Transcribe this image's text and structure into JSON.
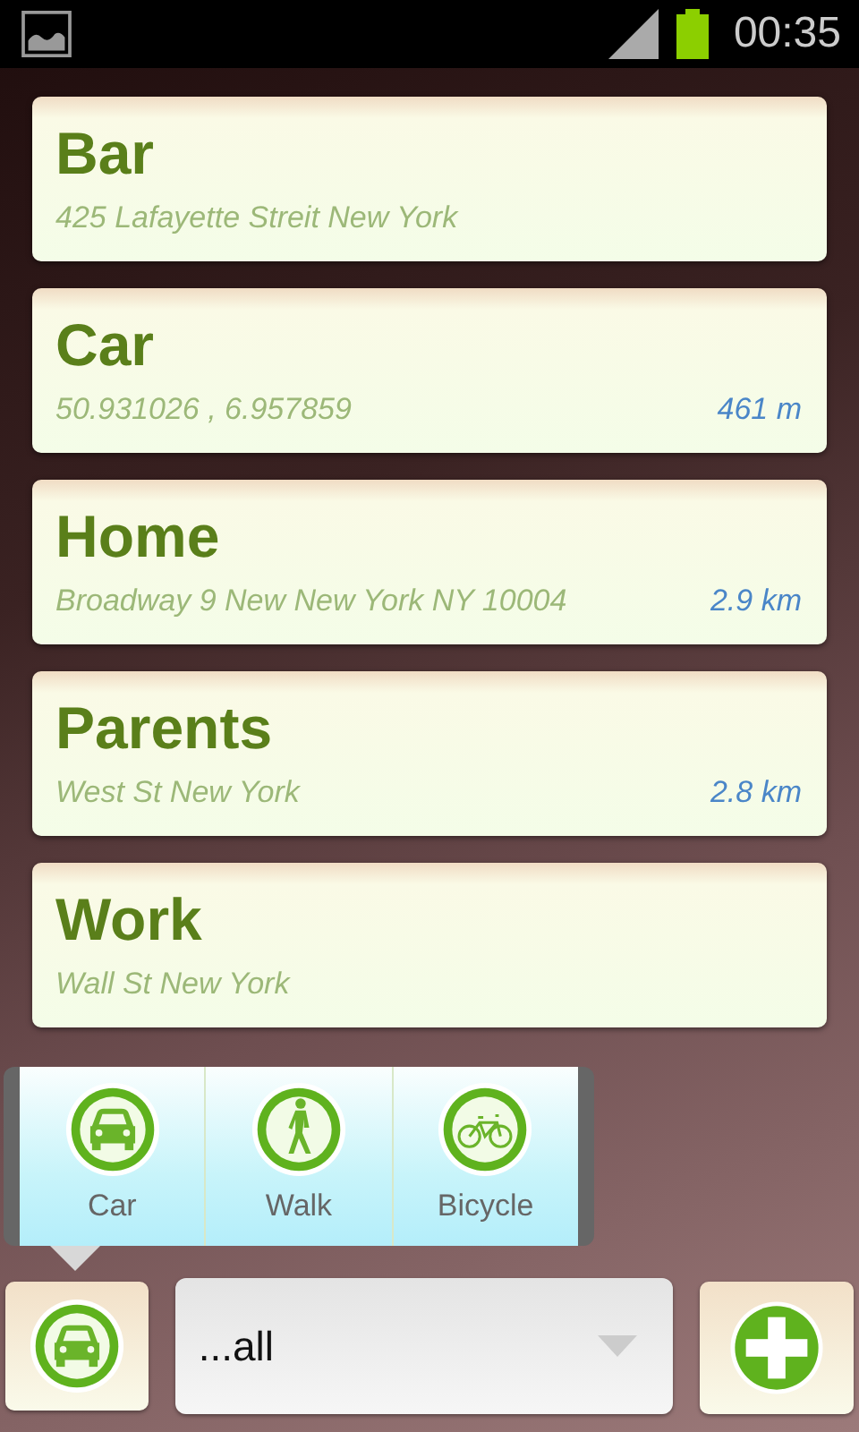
{
  "status_bar": {
    "time": "00:35"
  },
  "places": [
    {
      "name": "Bar",
      "address": "425 Lafayette Streit New York"
    },
    {
      "name": "Car",
      "address": "50.931026 , 6.957859",
      "distance": "461 m"
    },
    {
      "name": "Home",
      "address": "Broadway 9 New New York NY 10004",
      "distance": "2.9 km"
    },
    {
      "name": "Parents",
      "address": "West St New York",
      "distance": "2.8 km"
    },
    {
      "name": "Work",
      "address": "Wall St New York"
    }
  ],
  "mode_popup": {
    "items": [
      {
        "kind": "car",
        "label": "Car"
      },
      {
        "kind": "walk",
        "label": "Walk"
      },
      {
        "kind": "bicycle",
        "label": "Bicycle"
      }
    ]
  },
  "bottom_bar": {
    "mode_button": {
      "kind": "car"
    },
    "filter": {
      "value": "...all"
    }
  }
}
